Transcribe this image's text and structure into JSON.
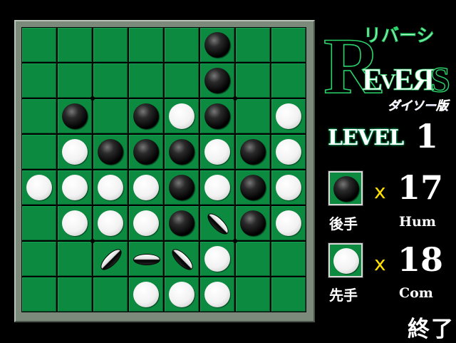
{
  "game": {
    "title_kana": "リバーシ",
    "title_latin": "REVERS",
    "edition": "ダイソー版",
    "level_label": "LEVEL",
    "level_value": "1",
    "end_label": "終了"
  },
  "score": {
    "black": {
      "count": "17",
      "multiplier": "x",
      "turn_label": "後手",
      "player_label": "Hum"
    },
    "white": {
      "count": "18",
      "multiplier": "x",
      "turn_label": "先手",
      "player_label": "Com"
    }
  },
  "board": {
    "size": 8,
    "rows": [
      [
        "",
        "",
        "",
        "",
        "",
        "B",
        "",
        ""
      ],
      [
        "",
        "",
        "",
        "",
        "",
        "B",
        "",
        ""
      ],
      [
        "",
        "B",
        "",
        "B",
        "W",
        "B",
        "",
        "W"
      ],
      [
        "",
        "W",
        "B",
        "B",
        "B",
        "W",
        "B",
        "W"
      ],
      [
        "W",
        "W",
        "W",
        "W",
        "B",
        "W",
        "B",
        "W"
      ],
      [
        "",
        "W",
        "W",
        "W",
        "B",
        "F",
        "B",
        "W"
      ],
      [
        "",
        "",
        "F",
        "F",
        "F",
        "W",
        "",
        ""
      ],
      [
        "",
        "",
        "",
        "W",
        "W",
        "W",
        "",
        ""
      ]
    ],
    "legend": {
      "B": "black disc",
      "W": "white disc",
      "F": "disc flipping"
    }
  },
  "colors": {
    "board_green": "#0b8a40",
    "accent_yellow": "#ffe000",
    "logo_green": "#2bd36b",
    "edition_blue": "#6f7bff"
  }
}
